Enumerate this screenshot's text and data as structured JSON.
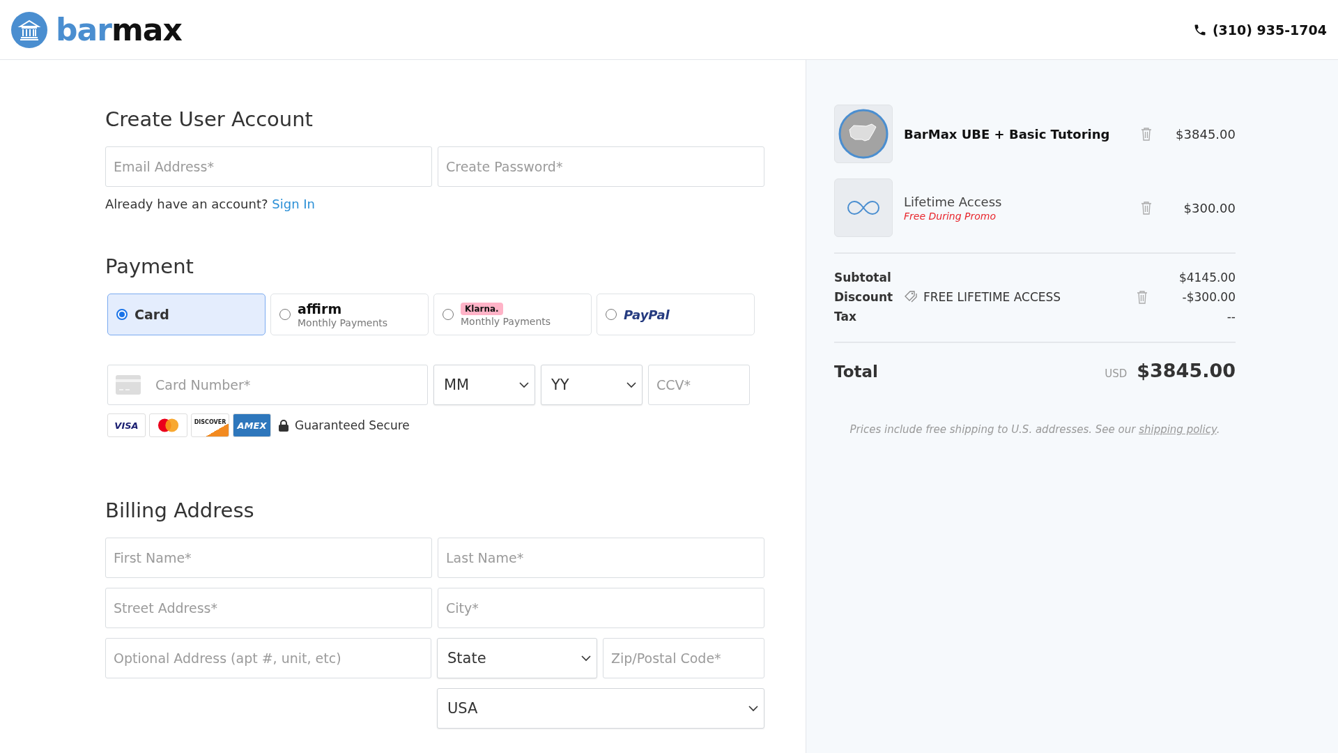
{
  "header": {
    "logo": [
      "bar",
      "max"
    ],
    "phone": "(310) 935-1704"
  },
  "account": {
    "title": "Create User Account",
    "fields": [
      {
        "placeholder": "Email Address*"
      },
      {
        "placeholder": "Create Password*"
      }
    ],
    "signin_prompt": "Already have an account?",
    "signin_link": "Sign In"
  },
  "payment": {
    "title": "Payment",
    "options": [
      {
        "kind": "card",
        "label": "Card",
        "selected": true
      },
      {
        "kind": "affirm",
        "label": "affirm",
        "sub": "Monthly Payments",
        "selected": false
      },
      {
        "kind": "klarna",
        "label": "Klarna.",
        "sub": "Monthly Payments",
        "selected": false
      },
      {
        "kind": "paypal",
        "label": "PayPal",
        "selected": false
      }
    ],
    "card_number": {
      "placeholder": "Card Number*"
    },
    "month": {
      "value": "MM"
    },
    "year": {
      "value": "YY"
    },
    "ccv": {
      "placeholder": "CCV*"
    },
    "brands": [
      {
        "kind": "visa",
        "label": "VISA"
      },
      {
        "kind": "mastercard"
      },
      {
        "kind": "discover",
        "label": "DISCOVER"
      },
      {
        "kind": "amex",
        "label": "AMEX"
      }
    ],
    "secure": "Guaranteed Secure"
  },
  "billing": {
    "title": "Billing Address",
    "first_name": {
      "placeholder": "First Name*"
    },
    "last_name": {
      "placeholder": "Last Name*"
    },
    "street": {
      "placeholder": "Street Address*"
    },
    "city": {
      "placeholder": "City*"
    },
    "optional": {
      "placeholder": "Optional Address (apt #, unit, etc)"
    },
    "state": {
      "value": "State"
    },
    "zip": {
      "placeholder": "Zip/Postal Code*"
    },
    "country": {
      "value": "USA"
    }
  },
  "cart": {
    "items": [
      {
        "kind": "course",
        "name": "BarMax UBE + Basic Tutoring",
        "price": "$3845.00"
      },
      {
        "kind": "lifetime",
        "name": "Lifetime Access",
        "note": "Free During Promo",
        "price": "$300.00"
      }
    ],
    "subtotal": {
      "label": "Subtotal",
      "value": "$4145.00"
    },
    "discount": {
      "label": "Discount",
      "code": "FREE LIFETIME ACCESS",
      "value": "-$300.00"
    },
    "tax": {
      "label": "Tax",
      "value": "--"
    },
    "total": {
      "label": "Total",
      "currency": "USD",
      "value": "$3845.00"
    },
    "note": {
      "text": "Prices include free shipping to U.S. addresses. See our ",
      "link": "shipping policy",
      "end": "."
    }
  }
}
